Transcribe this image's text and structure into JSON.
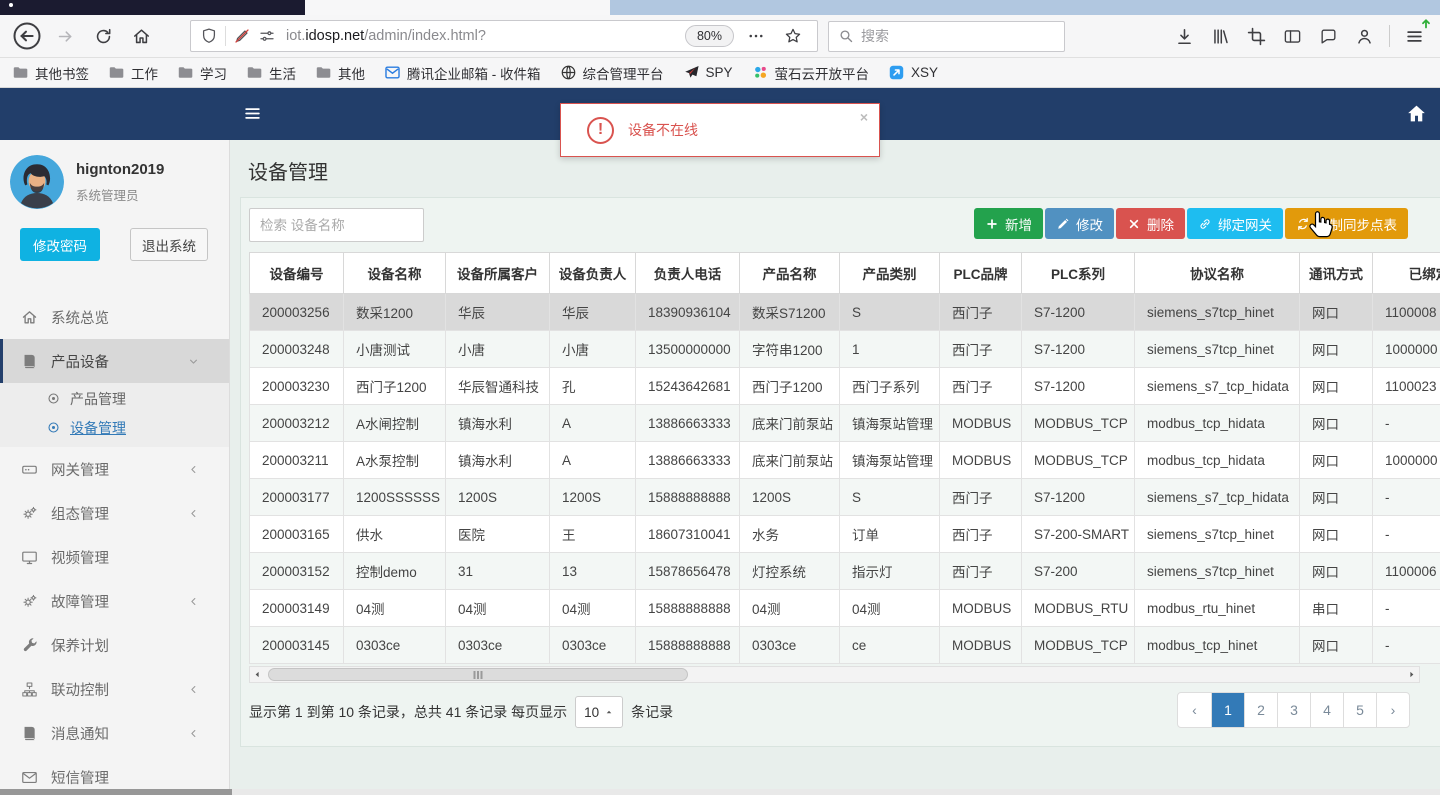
{
  "browser": {
    "url": {
      "prefix": "iot.",
      "domain": "idosp.net",
      "path": "/admin/index.html?"
    },
    "zoom_badge": "80%",
    "search_placeholder": "搜索",
    "bookmarks": [
      {
        "label": "其他书签",
        "icon": "folder"
      },
      {
        "label": "工作",
        "icon": "folder"
      },
      {
        "label": "学习",
        "icon": "folder"
      },
      {
        "label": "生活",
        "icon": "folder"
      },
      {
        "label": "其他",
        "icon": "folder"
      },
      {
        "label": "腾讯企业邮箱 - 收件箱",
        "icon": "tencent"
      },
      {
        "label": "综合管理平台",
        "icon": "globe"
      },
      {
        "label": "SPY",
        "icon": "plane"
      },
      {
        "label": "萤石云开放平台",
        "icon": "ezviz"
      },
      {
        "label": "XSY",
        "icon": "xsy"
      }
    ]
  },
  "sidebar": {
    "username": "hignton2019",
    "role": "系统管理员",
    "buttons": {
      "change_password": "修改密码",
      "logout": "退出系统"
    },
    "menu": [
      {
        "label": "系统总览",
        "icon": "home"
      },
      {
        "label": "产品设备",
        "icon": "book",
        "active": true,
        "chevron": "down",
        "children": [
          {
            "label": "产品管理",
            "icon": "bullseye"
          },
          {
            "label": "设备管理",
            "icon": "bullseye",
            "active": true
          }
        ]
      },
      {
        "label": "网关管理",
        "icon": "hdd",
        "chevron": "left"
      },
      {
        "label": "组态管理",
        "icon": "gears",
        "chevron": "left"
      },
      {
        "label": "视频管理",
        "icon": "monitor"
      },
      {
        "label": "故障管理",
        "icon": "gears",
        "chevron": "left"
      },
      {
        "label": "保养计划",
        "icon": "wrench"
      },
      {
        "label": "联动控制",
        "icon": "sitemap",
        "chevron": "left"
      },
      {
        "label": "消息通知",
        "icon": "book",
        "chevron": "left"
      },
      {
        "label": "短信管理",
        "icon": "envelope"
      }
    ]
  },
  "alert": {
    "message": "设备不在线",
    "icon_glyph": "!",
    "close_glyph": "×"
  },
  "main": {
    "title": "设备管理",
    "search_placeholder": "检索 设备名称",
    "action_buttons": [
      {
        "label": "新增",
        "icon": "plus",
        "color": "#23a24d"
      },
      {
        "label": "修改",
        "icon": "pencil",
        "color": "#5191c1"
      },
      {
        "label": "删除",
        "icon": "close",
        "color": "#d9534f"
      },
      {
        "label": "绑定网关",
        "icon": "link",
        "color": "#1ebdf0"
      },
      {
        "label": "复制同步点表",
        "icon": "refresh",
        "color": "#e29a0b"
      }
    ],
    "table": {
      "columns": [
        "设备编号",
        "设备名称",
        "设备所属客户",
        "设备负责人",
        "负责人电话",
        "产品名称",
        "产品类别",
        "PLC品牌",
        "PLC系列",
        "协议名称",
        "通讯方式",
        "已绑定网关"
      ],
      "selected_row_index": 0,
      "rows": [
        [
          "200003256",
          "数采1200",
          "华辰",
          "华辰",
          "18390936104",
          "数采S71200",
          "S",
          "西门子",
          "S7-1200",
          "siemens_s7tcp_hinet",
          "网口",
          "1100008"
        ],
        [
          "200003248",
          "小唐测试",
          "小唐",
          "小唐",
          "13500000000",
          "字符串1200",
          "1",
          "西门子",
          "S7-1200",
          "siemens_s7tcp_hinet",
          "网口",
          "1000000"
        ],
        [
          "200003230",
          "西门子1200",
          "华辰智通科技",
          "孔",
          "15243642681",
          "西门子1200",
          "西门子系列",
          "西门子",
          "S7-1200",
          "siemens_s7_tcp_hidata",
          "网口",
          "1100023"
        ],
        [
          "200003212",
          "A水闸控制",
          "镇海水利",
          "A",
          "13886663333",
          "底来门前泵站",
          "镇海泵站管理",
          "MODBUS",
          "MODBUS_TCP",
          "modbus_tcp_hidata",
          "网口",
          "-"
        ],
        [
          "200003211",
          "A水泵控制",
          "镇海水利",
          "A",
          "13886663333",
          "底来门前泵站",
          "镇海泵站管理",
          "MODBUS",
          "MODBUS_TCP",
          "modbus_tcp_hidata",
          "网口",
          "1000000"
        ],
        [
          "200003177",
          "1200SSSSSS",
          "1200S",
          "1200S",
          "15888888888",
          "1200S",
          "S",
          "西门子",
          "S7-1200",
          "siemens_s7_tcp_hidata",
          "网口",
          "-"
        ],
        [
          "200003165",
          "供水",
          "医院",
          "王",
          "18607310041",
          "水务",
          "订单",
          "西门子",
          "S7-200-SMART",
          "siemens_s7tcp_hinet",
          "网口",
          "-"
        ],
        [
          "200003152",
          "控制demo",
          "31",
          "13",
          "15878656478",
          "灯控系统",
          "指示灯",
          "西门子",
          "S7-200",
          "siemens_s7tcp_hinet",
          "网口",
          "1100006"
        ],
        [
          "200003149",
          "04测",
          "04测",
          "04测",
          "15888888888",
          "04测",
          "04测",
          "MODBUS",
          "MODBUS_RTU",
          "modbus_rtu_hinet",
          "串口",
          "-"
        ],
        [
          "200003145",
          "0303ce",
          "0303ce",
          "0303ce",
          "15888888888",
          "0303ce",
          "ce",
          "MODBUS",
          "MODBUS_TCP",
          "modbus_tcp_hinet",
          "网口",
          "-"
        ]
      ]
    },
    "pagination": {
      "summary_prefix": "显示第 1 到第 10 条记录，总共 41 条记录 每页显示",
      "page_size": "10",
      "summary_suffix": "条记录",
      "prev": "‹",
      "next": "›",
      "pages": [
        "1",
        "2",
        "3",
        "4",
        "5"
      ],
      "active_page": "1"
    }
  }
}
